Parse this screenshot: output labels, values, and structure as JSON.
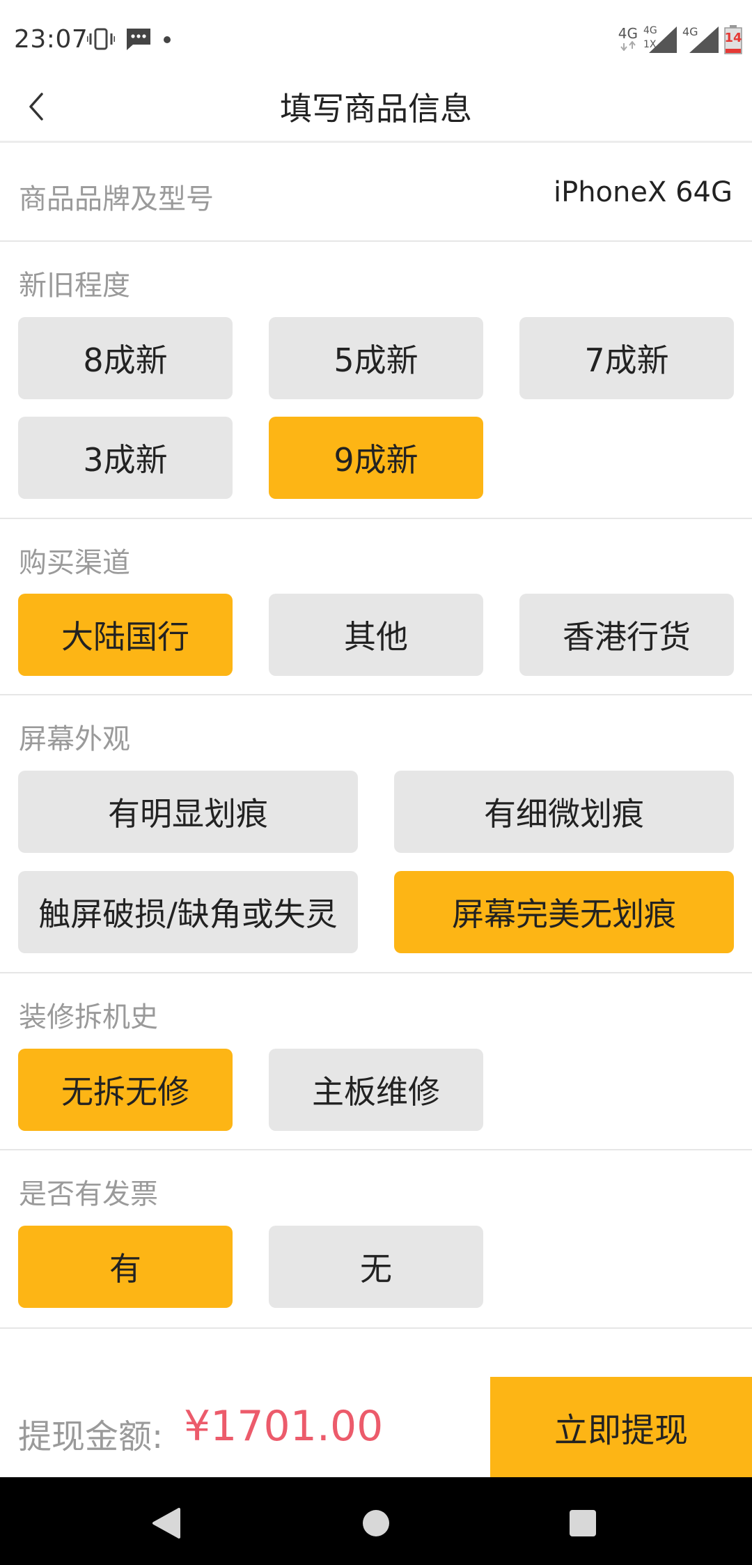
{
  "status_bar": {
    "time": "23:07",
    "network_1": "4G",
    "network_2_top": "4G",
    "network_2_bottom": "1X",
    "network_3": "4G",
    "battery_level": "14"
  },
  "header": {
    "title": "填写商品信息"
  },
  "brand": {
    "label": "商品品牌及型号",
    "value": "iPhoneX 64G"
  },
  "sections": {
    "condition": {
      "title": "新旧程度",
      "options": [
        "8成新",
        "5成新",
        "7成新",
        "3成新",
        "9成新"
      ],
      "selected": "9成新"
    },
    "channel": {
      "title": "购买渠道",
      "options": [
        "大陆国行",
        "其他",
        "香港行货"
      ],
      "selected": "大陆国行"
    },
    "screen": {
      "title": "屏幕外观",
      "options": [
        "有明显划痕",
        "有细微划痕",
        "触屏破损/缺角或失灵",
        "屏幕完美无划痕"
      ],
      "selected": "屏幕完美无划痕"
    },
    "repair": {
      "title": "装修拆机史",
      "options": [
        "无拆无修",
        "主板维修"
      ],
      "selected": "无拆无修"
    },
    "invoice": {
      "title": "是否有发票",
      "options": [
        "有",
        "无"
      ],
      "selected": "有"
    }
  },
  "bottom": {
    "amount_label": "提现金额:",
    "amount_value": "¥1701.00",
    "withdraw_label": "立即提现"
  },
  "colors": {
    "accent": "#fdb515",
    "price": "#ec5b6b",
    "option_bg": "#e6e6e6",
    "muted_text": "#9a9a9a"
  },
  "icons": {
    "back": "chevron-left-icon",
    "vibrate": "vibrate-icon",
    "message": "message-icon",
    "nav_back": "triangle-back-icon",
    "nav_home": "circle-home-icon",
    "nav_recent": "square-recent-icon"
  }
}
